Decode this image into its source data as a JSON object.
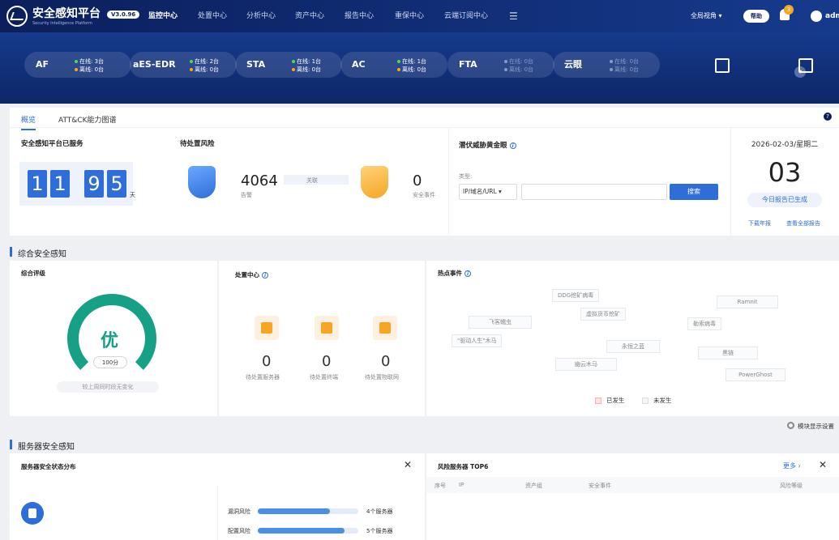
{
  "header": {
    "brand": "安全感知平台",
    "brand_sub": "Security Intelligence Platform",
    "version": "V3.0.96",
    "nav": [
      "监控中心",
      "处置中心",
      "分析中心",
      "资产中心",
      "报告中心",
      "重保中心",
      "云端订阅中心"
    ],
    "view": "全局视角 ▾",
    "help": "帮助",
    "notif_count": "3",
    "user": "admi",
    "menu_icon": "menu-icon"
  },
  "devices": [
    {
      "name": "AF",
      "online": "在线: 3台",
      "offline": "离线: 0台"
    },
    {
      "name": "aES-EDR",
      "online": "在线: 2台",
      "offline": "离线: 0台"
    },
    {
      "name": "STA",
      "online": "在线: 1台",
      "offline": "离线: 0台"
    },
    {
      "name": "AC",
      "online": "在线: 1台",
      "offline": "离线: 0台"
    },
    {
      "name": "FTA",
      "online": "在线: 0台",
      "offline": "离线: 0台"
    },
    {
      "name": "云眼",
      "online": "在线: 0台",
      "offline": "离线: 0台"
    }
  ],
  "colors": {
    "primary": "#2f6ed8",
    "online": "#4cd964",
    "offline": "#f5a623",
    "good": "#16a085"
  },
  "tabs": [
    "概览",
    "ATT&CK能力图谱"
  ],
  "overview": {
    "served_title": "安全感知平台已服务",
    "digits": [
      "1",
      "1",
      "9",
      "5"
    ],
    "day_unit": "天",
    "risk_title": "待处置风险",
    "alerts": "4064",
    "alerts_label": "告警",
    "flow_label": "关联",
    "events": "0",
    "events_label": "安全事件",
    "hunt_title": "潜伏威胁黄金眼",
    "type_label": "类型:",
    "type_value": "IP/域名/URL ▾",
    "search_btn": "搜索",
    "date": "2026-02-03/星期二",
    "day": "03",
    "report_status": "今日报告已生成",
    "download": "下载年报",
    "view_all": "查看全部报告"
  },
  "sec1": {
    "title": "综合安全感知",
    "rating_title": "综合评级",
    "rating": "优",
    "score": "100分",
    "rating_note": "较上周同时段无变化",
    "disposal_title": "处置中心",
    "disposal": [
      {
        "count": "0",
        "label": "待处置服务器"
      },
      {
        "count": "0",
        "label": "待处置终端"
      },
      {
        "count": "0",
        "label": "待处置物联网"
      }
    ],
    "hot_title": "热点事件",
    "hot_tags": [
      "DDG挖矿病毒",
      "Ramnit",
      "虚拟货币挖矿",
      "飞客蠕虫",
      "勒索病毒",
      "\"驱动人生\"木马",
      "永恒之蓝",
      "黑链",
      "幽云木马",
      "PowerGhost"
    ],
    "legend_happened": "已发生",
    "legend_not": "未发生",
    "module_settings": "模块显示设置"
  },
  "sec2": {
    "title": "服务器安全感知",
    "status_title": "服务器安全状态分布",
    "vuln_label": "漏洞风险",
    "vuln_value": "4个服务器",
    "vuln_fraction": 0.72,
    "config_label": "配置风险",
    "config_value": "5个服务器",
    "config_fraction": 0.86,
    "top_title": "风险服务器 TOP6",
    "more": "更多 ›",
    "cols": [
      "序号",
      "IP",
      "资产组",
      "安全事件",
      "风险等级"
    ]
  }
}
